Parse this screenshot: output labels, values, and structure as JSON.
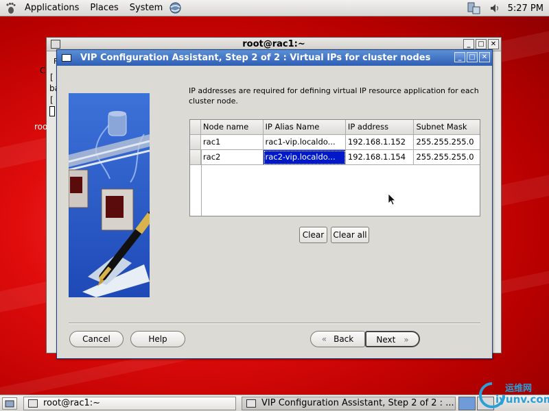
{
  "top_panel": {
    "menus": [
      "Applications",
      "Places",
      "System"
    ],
    "clock": "5:27 PM"
  },
  "terminal_window": {
    "title": "root@rac1:~",
    "fragments": [
      "C",
      "[",
      "ba",
      "[",
      "roo",
      "F"
    ]
  },
  "dialog": {
    "title": "VIP Configuration Assistant, Step 2 of 2 : Virtual IPs for cluster nodes",
    "instructions": "IP addresses are required for defining virtual IP resource application for each cluster node.",
    "table": {
      "columns": [
        "Node name",
        "IP Alias Name",
        "IP address",
        "Subnet Mask"
      ],
      "rows": [
        [
          "rac1",
          "rac1-vip.localdo...",
          "192.168.1.152",
          "255.255.255.0"
        ],
        [
          "rac2",
          "rac2-vip.localdo...",
          "192.168.1.154",
          "255.255.255.0"
        ]
      ]
    },
    "buttons": {
      "clear": "Clear",
      "clear_all": "Clear all",
      "cancel": "Cancel",
      "help": "Help",
      "back": "Back",
      "next": "Next"
    }
  },
  "taskbar": {
    "tasks": [
      "root@rac1:~",
      "VIP Configuration Assistant, Step 2 of 2 : ..."
    ]
  },
  "watermark": {
    "text": "运维网",
    "url": "iyunv.com"
  },
  "colors": {
    "desktop": "#e00c0c",
    "titlebar_active": "#2f5fb4",
    "selection": "#0019c8"
  }
}
